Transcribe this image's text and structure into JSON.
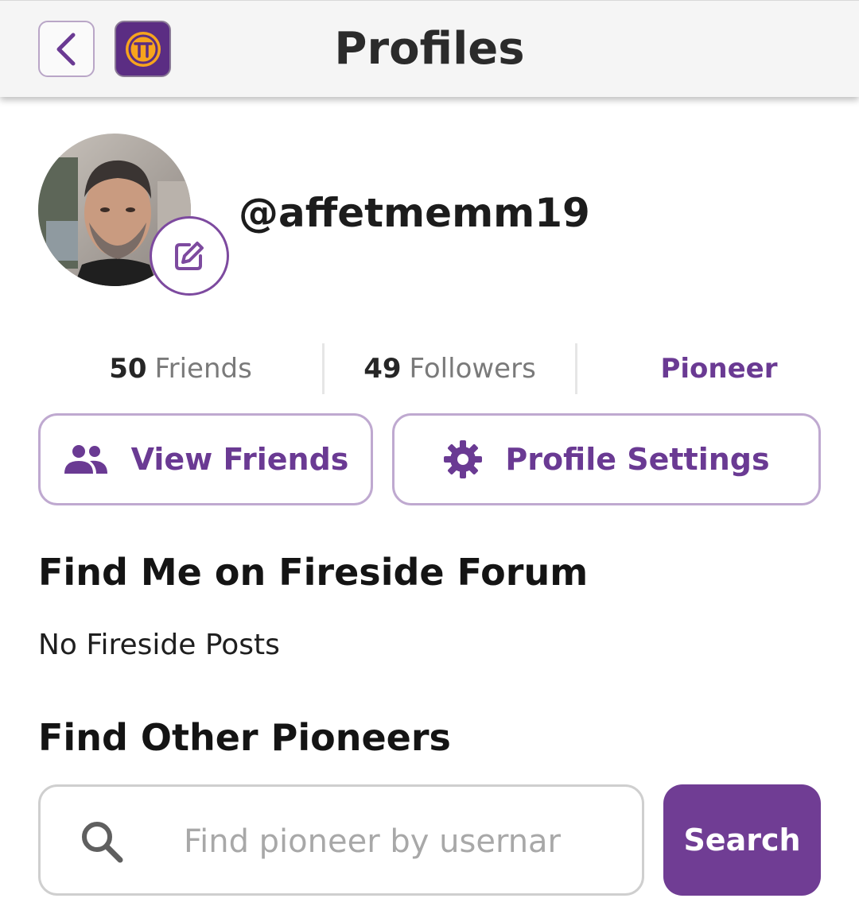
{
  "header": {
    "title": "Profiles",
    "back_icon": "chevron-left-icon",
    "logo_icon": "pi-logo-icon"
  },
  "profile": {
    "username": "@affetmemm19",
    "avatar": "user-avatar-photo",
    "edit_icon": "edit-icon"
  },
  "stats": {
    "friends": {
      "count": "50",
      "label": "Friends"
    },
    "followers": {
      "count": "49",
      "label": "Followers"
    },
    "role": "Pioneer"
  },
  "actions": {
    "view_friends": "View Friends",
    "profile_settings": "Profile Settings"
  },
  "fireside": {
    "title": "Find Me on Fireside Forum",
    "empty_text": "No Fireside Posts"
  },
  "find_pioneers": {
    "title": "Find Other Pioneers",
    "placeholder": "Find pioneer by usernar",
    "search_label": "Search"
  },
  "colors": {
    "accent": "#703d94",
    "accent_border": "#bfa9d0",
    "header_bg": "#f5f5f5"
  }
}
